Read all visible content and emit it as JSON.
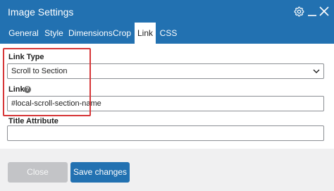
{
  "window": {
    "title": "Image Settings",
    "icons": [
      "gear-icon",
      "minimize-icon",
      "close-icon"
    ]
  },
  "tabs": [
    {
      "label": "General"
    },
    {
      "label": "Style"
    },
    {
      "label": "Dimensions"
    },
    {
      "label": "Crop"
    },
    {
      "label": "Link",
      "active": true
    },
    {
      "label": "CSS"
    }
  ],
  "form": {
    "link_type": {
      "label": "Link Type",
      "value": "Scroll to Section"
    },
    "link": {
      "label": "Link",
      "help": "?",
      "value": "#local-scroll-section-name"
    },
    "title_attribute": {
      "label": "Title Attribute",
      "value": ""
    }
  },
  "buttons": {
    "close": "Close",
    "save": "Save changes"
  },
  "colors": {
    "accent": "#2271b1",
    "highlight": "#d63638",
    "disabled": "#c3c4c7"
  }
}
